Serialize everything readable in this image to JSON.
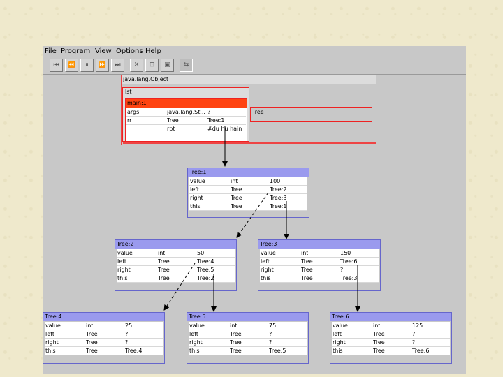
{
  "menu": [
    "File",
    "Program",
    "View",
    "Options",
    "Help"
  ],
  "toolbar": [
    "⏮",
    "⏪",
    "⏸",
    "⏩",
    "⏭",
    "✕",
    "⊡",
    "▣",
    "⇆"
  ],
  "object": {
    "title": "java.lang.Object",
    "lst": "lst"
  },
  "main": {
    "title": "main:1",
    "rows": [
      [
        "args",
        "java.lang.St...",
        "?"
      ],
      [
        "rr",
        "Tree",
        "Tree:1"
      ],
      [
        "",
        "rpt",
        "#du hu hain"
      ]
    ]
  },
  "tree_label": "Tree",
  "nodes": [
    {
      "title": "Tree:1",
      "rows": [
        [
          "value",
          "int",
          "100"
        ],
        [
          "left",
          "Tree",
          "Tree:2"
        ],
        [
          "right",
          "Tree",
          "Tree:3"
        ],
        [
          "this",
          "Tree",
          "Tree:1"
        ]
      ]
    },
    {
      "title": "Tree:2",
      "rows": [
        [
          "value",
          "int",
          "50"
        ],
        [
          "left",
          "Tree",
          "Tree:4"
        ],
        [
          "right",
          "Tree",
          "Tree:5"
        ],
        [
          "this",
          "Tree",
          "Tree:2"
        ]
      ]
    },
    {
      "title": "Tree:3",
      "rows": [
        [
          "value",
          "int",
          "150"
        ],
        [
          "left",
          "Tree",
          "Tree:6"
        ],
        [
          "right",
          "Tree",
          "?"
        ],
        [
          "this",
          "Tree",
          "Tree:3"
        ]
      ]
    },
    {
      "title": "Tree:4",
      "rows": [
        [
          "value",
          "int",
          "25"
        ],
        [
          "left",
          "Tree",
          "?"
        ],
        [
          "right",
          "Tree",
          "?"
        ],
        [
          "this",
          "Tree",
          "Tree:4"
        ]
      ]
    },
    {
      "title": "Tree:5",
      "rows": [
        [
          "value",
          "int",
          "75"
        ],
        [
          "left",
          "Tree",
          "?"
        ],
        [
          "right",
          "Tree",
          "?"
        ],
        [
          "this",
          "Tree",
          "Tree:5"
        ]
      ]
    },
    {
      "title": "Tree:6",
      "rows": [
        [
          "value",
          "int",
          "125"
        ],
        [
          "left",
          "Tree",
          "?"
        ],
        [
          "right",
          "Tree",
          "?"
        ],
        [
          "this",
          "Tree",
          "Tree:6"
        ]
      ]
    }
  ]
}
